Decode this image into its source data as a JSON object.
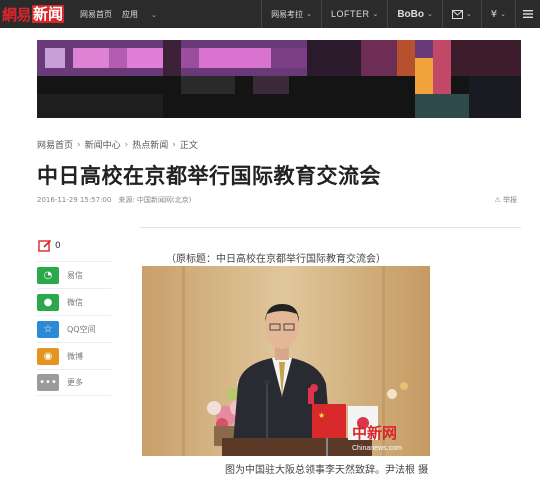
{
  "topbar": {
    "logo_mark": "網易",
    "logo_sub": "新闻",
    "nav_left": [
      "网易首页",
      "应用"
    ],
    "nav_right": [
      "网易考拉",
      "LOFTER",
      "BoBo"
    ]
  },
  "breadcrumb": [
    "网易首页",
    "新闻中心",
    "热点新闻",
    "正文"
  ],
  "article": {
    "title": "中日高校在京都举行国际教育交流会",
    "meta": "2016-11-29 15:57:00　来源: 中国新闻网(北京)",
    "report_label": "举报",
    "original_title": "（原标题：中日高校在京都举行国际教育交流会）",
    "photo_caption": "图为中国驻大阪总领事李天然致辞。尹法根 摄",
    "watermark": "中新网",
    "watermark_url": "Chinanews.com"
  },
  "share": {
    "comment_count": "0",
    "items": [
      {
        "label": "易信",
        "icon": "yixin-icon",
        "color": "#2aa84a"
      },
      {
        "label": "微信",
        "icon": "wechat-icon",
        "color": "#2aa84a"
      },
      {
        "label": "QQ空间",
        "icon": "qzone-icon",
        "color": "#2b8ad6"
      },
      {
        "label": "微博",
        "icon": "weibo-icon",
        "color": "#e3961f"
      },
      {
        "label": "更多",
        "icon": "more-icon",
        "color": "#9b9b9b"
      }
    ]
  },
  "colors": {
    "topbar": "#2b2b2b",
    "brand_red": "#d8262b"
  }
}
